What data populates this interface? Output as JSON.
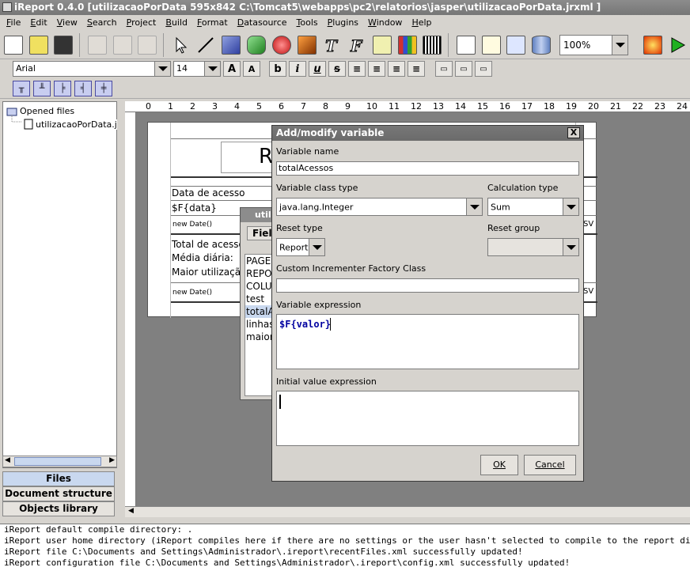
{
  "window": {
    "title": "iReport 0.4.0  [utilizacaoPorData 595x842 C:\\Tomcat5\\webapps\\pc2\\relatorios\\jasper\\utilizacaoPorData.jrxml ]"
  },
  "menu": {
    "items": [
      "File",
      "Edit",
      "View",
      "Search",
      "Project",
      "Build",
      "Format",
      "Datasource",
      "Tools",
      "Plugins",
      "Window",
      "Help"
    ]
  },
  "toolbar": {
    "zoom": "100%"
  },
  "font_toolbar": {
    "font": "Arial",
    "size": "14",
    "bold": "b",
    "italic": "i",
    "underline": "u",
    "strike": "s"
  },
  "left_panel": {
    "root_label": "Opened files",
    "file_label": "utilizacaoPorData.j",
    "tabs": [
      "Files",
      "Document structure",
      "Objects library"
    ]
  },
  "ruler": {
    "marks": [
      "0",
      "1",
      "2",
      "3",
      "4",
      "5",
      "6",
      "7",
      "8",
      "9",
      "10",
      "11",
      "12",
      "13",
      "14",
      "15",
      "16",
      "17",
      "18",
      "19",
      "20",
      "21",
      "22",
      "23",
      "24"
    ]
  },
  "report": {
    "title_initial": "R",
    "data_label": "Data de acesso",
    "field_data": "$F{data}",
    "new_date_1": "new Date()",
    "total_label": "Total de acesso",
    "media_label": "Média diária:",
    "maior_label": "Maior utilização:",
    "new_date_2": "new Date()",
    "sv_1": "SV",
    "sv_2": "SV"
  },
  "background_window": {
    "title": "utili",
    "tab": "Field",
    "items": [
      "PAGE",
      "REPO",
      "COLU",
      "test",
      "totalAc",
      "linhas",
      "maior."
    ]
  },
  "dialog": {
    "title": "Add/modify variable",
    "close": "X",
    "variable_name_label": "Variable name",
    "variable_name": "totalAcessos",
    "class_type_label": "Variable class type",
    "class_type": "java.lang.Integer",
    "calc_type_label": "Calculation type",
    "calc_type": "Sum",
    "reset_type_label": "Reset type",
    "reset_type": "Report",
    "reset_group_label": "Reset group",
    "reset_group": "",
    "incrementer_label": "Custom Incrementer Factory Class",
    "incrementer": "",
    "expression_label": "Variable expression",
    "expression": "$F{valor}",
    "initial_label": "Initial value expression",
    "initial": "",
    "ok": "OK",
    "cancel": "Cancel"
  },
  "console": {
    "lines": [
      "iReport default compile directory: .",
      "iReport user home directory (iReport compiles here if there are no settings or the user hasn't selected to compile to the report directory)",
      "iReport file C:\\Documents and Settings\\Administrador\\.ireport\\recentFiles.xml successfully updated!",
      "iReport configuration file C:\\Documents and Settings\\Administrador\\.ireport\\config.xml successfully updated!"
    ]
  },
  "colors": {
    "title_bg": "#767676",
    "workspace": "#808080",
    "selection": "#c9d8ef",
    "expression_text": "#0000a0"
  }
}
